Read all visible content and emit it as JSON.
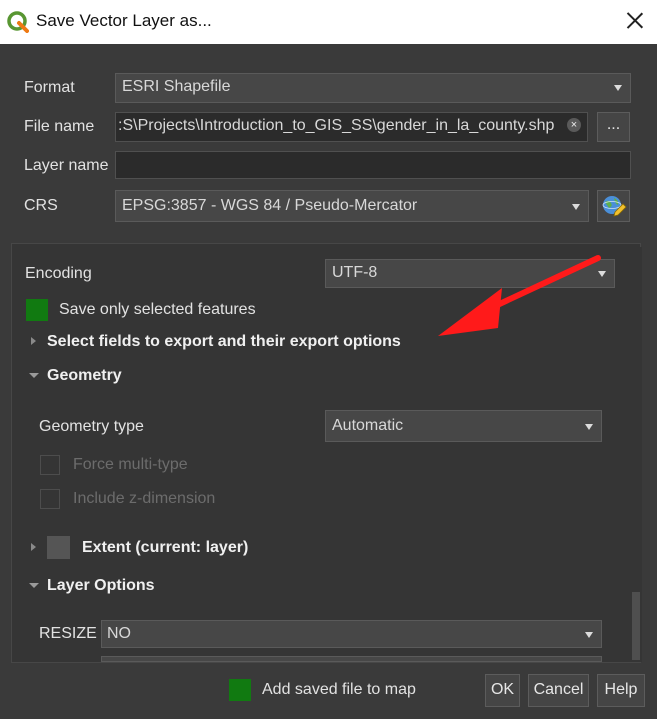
{
  "window": {
    "title": "Save Vector Layer as...",
    "app_icon": "qgis-icon",
    "close_icon": "close-icon"
  },
  "form": {
    "format": {
      "label": "Format",
      "value": "ESRI Shapefile"
    },
    "file_name": {
      "label": "File name",
      "value": ":S\\Projects\\Introduction_to_GIS_SS\\gender_in_la_county.shp",
      "clear_icon": "×",
      "browse_label": "..."
    },
    "layer_name": {
      "label": "Layer name",
      "value": ""
    },
    "crs": {
      "label": "CRS",
      "value": "EPSG:3857 - WGS 84 / Pseudo-Mercator",
      "button_icon": "globe-select-crs-icon"
    }
  },
  "options": {
    "encoding": {
      "label": "Encoding",
      "value": "UTF-8"
    },
    "save_only_selected": {
      "label": "Save only selected features",
      "checked": true
    },
    "select_fields": {
      "label": "Select fields to export and their export options",
      "expanded": false
    },
    "geometry": {
      "label": "Geometry",
      "expanded": true,
      "geometry_type": {
        "label": "Geometry type",
        "value": "Automatic"
      },
      "force_multi": {
        "label": "Force multi-type",
        "checked": false,
        "enabled": false
      },
      "include_z": {
        "label": "Include z-dimension",
        "checked": false,
        "enabled": false
      }
    },
    "extent": {
      "label": "Extent (current: layer)",
      "expanded": false,
      "checked": false
    },
    "layer_options": {
      "label": "Layer Options",
      "expanded": true,
      "resize": {
        "label": "RESIZE",
        "value": "NO"
      }
    }
  },
  "annotation": {
    "color": "#ff1a1a"
  },
  "footer": {
    "add_saved": {
      "label": "Add saved file to map",
      "checked": true
    },
    "ok_label": "OK",
    "cancel_label": "Cancel",
    "help_label": "Help"
  },
  "colors": {
    "checkbox_green": "#117a11",
    "background": "#3a3a3a"
  }
}
